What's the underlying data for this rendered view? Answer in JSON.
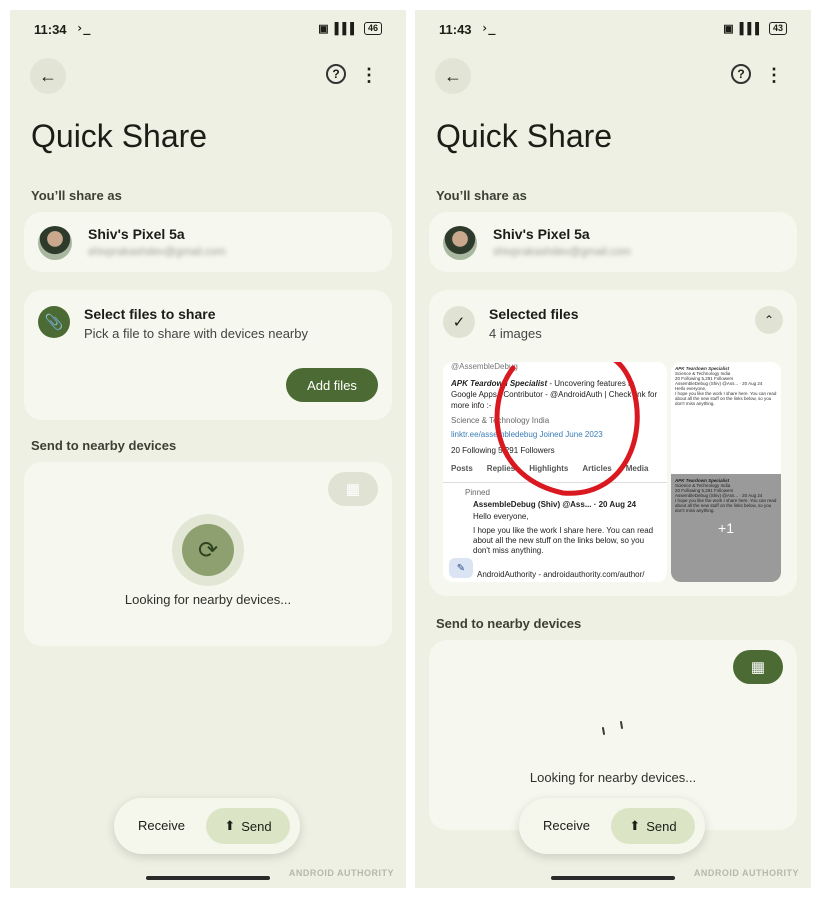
{
  "left": {
    "status": {
      "time": "11:34",
      "prompt": "›_",
      "battery": "46",
      "signal": "▌▌▌"
    },
    "title": "Quick Share",
    "share_as_label": "You’ll share as",
    "account": {
      "name": "Shiv's Pixel 5a",
      "email": "shivprakashdev@gmail.com"
    },
    "select": {
      "title": "Select files to share",
      "subtitle": "Pick a file to share with devices nearby",
      "add_button": "Add files"
    },
    "send_label": "Send to nearby devices",
    "looking": "Looking for nearby devices...",
    "toggle": {
      "receive": "Receive",
      "send": "Send"
    },
    "watermark": "ANDROID AUTHORITY"
  },
  "right": {
    "status": {
      "time": "11:43",
      "prompt": "›_",
      "battery": "43",
      "signal": "▌▌▌"
    },
    "title": "Quick Share",
    "share_as_label": "You’ll share as",
    "account": {
      "name": "Shiv's Pixel 5a",
      "email": "shivprakashdev@gmail.com"
    },
    "selected": {
      "title": "Selected files",
      "count": "4 images",
      "more_badge": "+1"
    },
    "preview": {
      "handle": "@AssembleDebug",
      "bio_bold": "APK Teardown Specialist",
      "bio_rest": " - Uncovering features in Google Apps | Contributor - @AndroidAuth | Check link for more info :-",
      "meta1": "Science & Technology   India",
      "meta2": "linktr.ee/assembledebug   Joined June 2023",
      "stats": "20 Following   5,291 Followers",
      "tabs": [
        "Posts",
        "Replies",
        "Highlights",
        "Articles",
        "Media"
      ],
      "pinned": "Pinned",
      "post_author": "AssembleDebug (Shiv) @Ass... · 20 Aug 24",
      "post_line1": "Hello everyone,",
      "post_line2": "I hope you like the work I share here. You can read about all the new stuff on the links below, so you don't miss anything.",
      "post_line3": "AndroidAuthority - androidauthority.com/author/"
    },
    "send_label": "Send to nearby devices",
    "looking": "Looking for nearby devices...",
    "toggle": {
      "receive": "Receive",
      "send": "Send"
    },
    "watermark": "ANDROID AUTHORITY"
  },
  "colors": {
    "accent": "#4c6a33",
    "background": "#eef0e3",
    "card": "#f6f7ee",
    "annotation": "#d9181f"
  }
}
